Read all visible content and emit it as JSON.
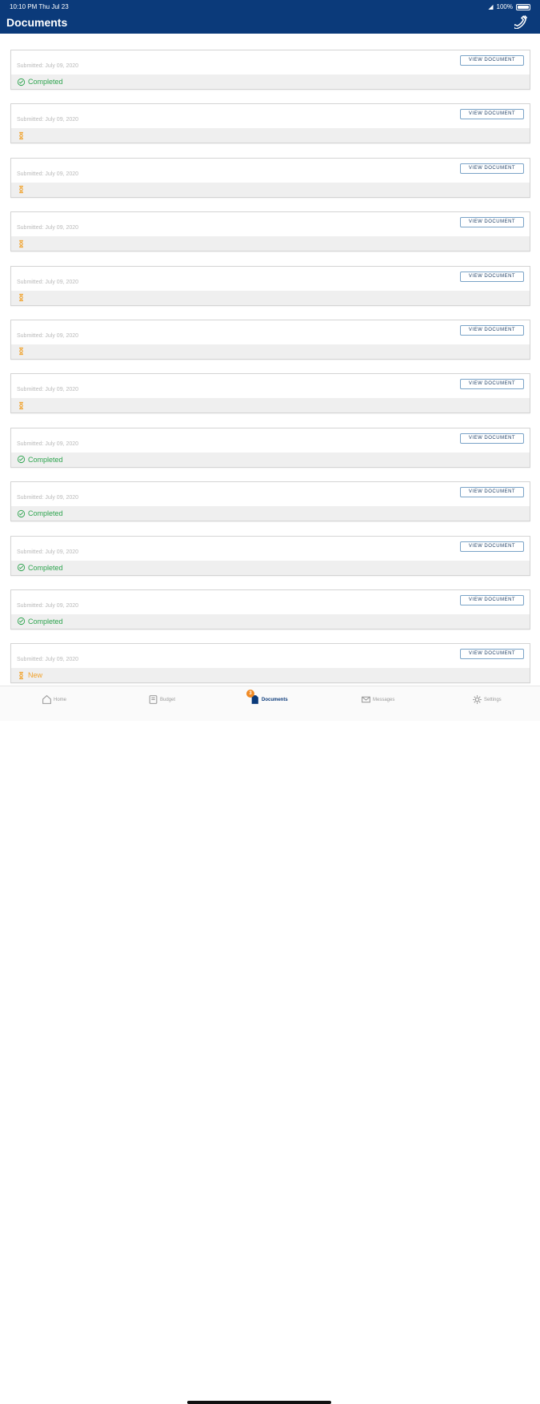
{
  "status_bar": {
    "time": "10:10 PM  Thu Jul 23",
    "battery": "100%"
  },
  "header": {
    "title": "Documents"
  },
  "documents": [
    {
      "submitted": "Submitted: July 09, 2020",
      "button": "VIEW DOCUMENT",
      "status": "Completed",
      "state": "completed"
    },
    {
      "submitted": "Submitted: July 09, 2020",
      "button": "VIEW DOCUMENT",
      "status": "",
      "state": "pending"
    },
    {
      "submitted": "Submitted: July 09, 2020",
      "button": "VIEW DOCUMENT",
      "status": "",
      "state": "pending"
    },
    {
      "submitted": "Submitted: July 09, 2020",
      "button": "VIEW DOCUMENT",
      "status": "",
      "state": "pending"
    },
    {
      "submitted": "Submitted: July 09, 2020",
      "button": "VIEW DOCUMENT",
      "status": "",
      "state": "pending"
    },
    {
      "submitted": "Submitted: July 09, 2020",
      "button": "VIEW DOCUMENT",
      "status": "",
      "state": "pending"
    },
    {
      "submitted": "Submitted: July 09, 2020",
      "button": "VIEW DOCUMENT",
      "status": "",
      "state": "pending"
    },
    {
      "submitted": "Submitted: July 09, 2020",
      "button": "VIEW DOCUMENT",
      "status": "Completed",
      "state": "completed"
    },
    {
      "submitted": "Submitted: July 09, 2020",
      "button": "VIEW DOCUMENT",
      "status": "Completed",
      "state": "completed"
    },
    {
      "submitted": "Submitted: July 09, 2020",
      "button": "VIEW DOCUMENT",
      "status": "Completed",
      "state": "completed"
    },
    {
      "submitted": "Submitted: July 09, 2020",
      "button": "VIEW DOCUMENT",
      "status": "Completed",
      "state": "completed"
    },
    {
      "submitted": "Submitted: July 09, 2020",
      "button": "VIEW DOCUMENT",
      "status": "New",
      "state": "pending"
    }
  ],
  "tabs": [
    {
      "label": "Home",
      "icon": "home-icon"
    },
    {
      "label": "Budget",
      "icon": "budget-icon"
    },
    {
      "label": "Documents",
      "icon": "document-icon",
      "active": true,
      "badge": "3"
    },
    {
      "label": "Messages",
      "icon": "mail-icon"
    },
    {
      "label": "Settings",
      "icon": "gear-icon"
    }
  ],
  "colors": {
    "header": "#0b3a7a",
    "completed": "#2ea44f",
    "pending": "#f0a12a"
  }
}
